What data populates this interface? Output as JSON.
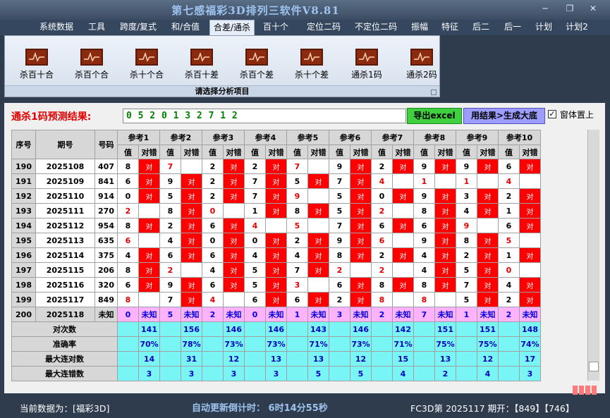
{
  "window": {
    "title": "第七感福彩3D排列三软件V8.81"
  },
  "menu": [
    "系统数据",
    "工具",
    "跨度/复式",
    "和/合值",
    "合差/通杀",
    "百十个",
    "定位二码",
    "不定位二码",
    "振幅",
    "特征",
    "后二",
    "后一",
    "计划",
    "计划2"
  ],
  "menu_active": "合差/通杀",
  "ribbon": {
    "items": [
      "杀百十合",
      "杀百个合",
      "杀十个合",
      "杀百十差",
      "杀百个差",
      "杀十个差",
      "通杀1码",
      "通杀2码"
    ],
    "group_label": "请选择分析项目"
  },
  "prediction": {
    "label": "通杀1码预测结果:",
    "value": "0 5 2 0 1 3 2 7 1 2"
  },
  "buttons": {
    "export": "导出excel",
    "generate": "用结果>生成大底"
  },
  "checkbox": {
    "label": "窗体置上",
    "checked_glyph": "✓"
  },
  "table": {
    "headers": {
      "seq": "序号",
      "issue": "期号",
      "code": "号码",
      "value": "值",
      "result": "对错"
    },
    "refs": [
      "参考1",
      "参考2",
      "参考3",
      "参考4",
      "参考5",
      "参考6",
      "参考7",
      "参考8",
      "参考9",
      "参考10"
    ],
    "rows": [
      {
        "seq": "190",
        "issue": "2025108",
        "code": "407",
        "cells": [
          [
            "8",
            "对"
          ],
          [
            "7",
            ""
          ],
          [
            "2",
            "对"
          ],
          [
            "2",
            "对"
          ],
          [
            "7",
            ""
          ],
          [
            "9",
            "对"
          ],
          [
            "2",
            "对"
          ],
          [
            "9",
            "对"
          ],
          [
            "9",
            "对"
          ],
          [
            "6",
            "对"
          ]
        ]
      },
      {
        "seq": "191",
        "issue": "2025109",
        "code": "841",
        "cells": [
          [
            "6",
            "对"
          ],
          [
            "9",
            "对"
          ],
          [
            "2",
            "对"
          ],
          [
            "7",
            "对"
          ],
          [
            "5",
            "对"
          ],
          [
            "7",
            "对"
          ],
          [
            "4",
            ""
          ],
          [
            "1",
            ""
          ],
          [
            "1",
            ""
          ],
          [
            "4",
            ""
          ]
        ]
      },
      {
        "seq": "192",
        "issue": "2025110",
        "code": "914",
        "cells": [
          [
            "0",
            "对"
          ],
          [
            "5",
            "对"
          ],
          [
            "2",
            "对"
          ],
          [
            "7",
            "对"
          ],
          [
            "9",
            ""
          ],
          [
            "5",
            "对"
          ],
          [
            "0",
            "对"
          ],
          [
            "9",
            "对"
          ],
          [
            "3",
            "对"
          ],
          [
            "2",
            "对"
          ]
        ]
      },
      {
        "seq": "193",
        "issue": "2025111",
        "code": "270",
        "cells": [
          [
            "2",
            ""
          ],
          [
            "8",
            "对"
          ],
          [
            "0",
            ""
          ],
          [
            "1",
            "对"
          ],
          [
            "8",
            "对"
          ],
          [
            "5",
            "对"
          ],
          [
            "2",
            ""
          ],
          [
            "8",
            "对"
          ],
          [
            "4",
            "对"
          ],
          [
            "1",
            "对"
          ]
        ]
      },
      {
        "seq": "194",
        "issue": "2025112",
        "code": "954",
        "cells": [
          [
            "8",
            "对"
          ],
          [
            "2",
            "对"
          ],
          [
            "6",
            "对"
          ],
          [
            "4",
            ""
          ],
          [
            "5",
            ""
          ],
          [
            "7",
            "对"
          ],
          [
            "6",
            "对"
          ],
          [
            "6",
            "对"
          ],
          [
            "9",
            ""
          ],
          [
            "6",
            "对"
          ]
        ]
      },
      {
        "seq": "195",
        "issue": "2025113",
        "code": "635",
        "cells": [
          [
            "6",
            ""
          ],
          [
            "4",
            "对"
          ],
          [
            "0",
            "对"
          ],
          [
            "0",
            "对"
          ],
          [
            "2",
            "对"
          ],
          [
            "9",
            "对"
          ],
          [
            "6",
            ""
          ],
          [
            "9",
            "对"
          ],
          [
            "8",
            "对"
          ],
          [
            "5",
            ""
          ]
        ]
      },
      {
        "seq": "196",
        "issue": "2025114",
        "code": "375",
        "cells": [
          [
            "4",
            "对"
          ],
          [
            "6",
            "对"
          ],
          [
            "6",
            "对"
          ],
          [
            "4",
            "对"
          ],
          [
            "4",
            "对"
          ],
          [
            "8",
            "对"
          ],
          [
            "2",
            "对"
          ],
          [
            "4",
            "对"
          ],
          [
            "2",
            "对"
          ],
          [
            "1",
            "对"
          ]
        ]
      },
      {
        "seq": "197",
        "issue": "2025115",
        "code": "206",
        "cells": [
          [
            "8",
            "对"
          ],
          [
            "2",
            ""
          ],
          [
            "4",
            "对"
          ],
          [
            "5",
            "对"
          ],
          [
            "7",
            "对"
          ],
          [
            "2",
            ""
          ],
          [
            "2",
            ""
          ],
          [
            "4",
            "对"
          ],
          [
            "5",
            "对"
          ],
          [
            "0",
            ""
          ]
        ]
      },
      {
        "seq": "198",
        "issue": "2025116",
        "code": "320",
        "cells": [
          [
            "6",
            "对"
          ],
          [
            "9",
            "对"
          ],
          [
            "6",
            "对"
          ],
          [
            "5",
            "对"
          ],
          [
            "3",
            ""
          ],
          [
            "6",
            "对"
          ],
          [
            "8",
            "对"
          ],
          [
            "8",
            "对"
          ],
          [
            "7",
            "对"
          ],
          [
            "4",
            "对"
          ]
        ]
      },
      {
        "seq": "199",
        "issue": "2025117",
        "code": "849",
        "cells": [
          [
            "8",
            ""
          ],
          [
            "7",
            "对"
          ],
          [
            "4",
            ""
          ],
          [
            "6",
            "对"
          ],
          [
            "6",
            "对"
          ],
          [
            "2",
            "对"
          ],
          [
            "8",
            ""
          ],
          [
            "8",
            ""
          ],
          [
            "5",
            "对"
          ],
          [
            "2",
            "对"
          ]
        ]
      }
    ],
    "unknown_row": {
      "seq": "200",
      "issue": "2025118",
      "code": "未知",
      "cells": [
        [
          "0",
          "未知"
        ],
        [
          "5",
          "未知"
        ],
        [
          "2",
          "未知"
        ],
        [
          "0",
          "未知"
        ],
        [
          "1",
          "未知"
        ],
        [
          "3",
          "未知"
        ],
        [
          "2",
          "未知"
        ],
        [
          "7",
          "未知"
        ],
        [
          "1",
          "未知"
        ],
        [
          "2",
          "未知"
        ]
      ]
    },
    "stats": [
      {
        "label": "对次数",
        "values": [
          "141",
          "156",
          "146",
          "146",
          "143",
          "146",
          "142",
          "151",
          "151",
          "148"
        ]
      },
      {
        "label": "准确率",
        "values": [
          "70%",
          "78%",
          "73%",
          "73%",
          "71%",
          "73%",
          "71%",
          "75%",
          "75%",
          "74%"
        ]
      },
      {
        "label": "最大连对数",
        "values": [
          "14",
          "31",
          "12",
          "13",
          "13",
          "12",
          "15",
          "13",
          "12",
          "17"
        ]
      },
      {
        "label": "最大连错数",
        "values": [
          "3",
          "3",
          "3",
          "3",
          "5",
          "5",
          "4",
          "2",
          "4",
          "3"
        ]
      }
    ]
  },
  "status": {
    "current_data": "当前数据为：[福彩3D]",
    "countdown": "自动更新倒计时：  6时14分55秒",
    "latest": "FC3D第 2025117 期开：【849】【746】"
  },
  "colors": {
    "hit": "#ff0000",
    "unknown_row": "#ffb3ff",
    "stats_row": "#7af5f5",
    "export_button": "#3fd03f",
    "generate_button": "#9d9dff"
  }
}
